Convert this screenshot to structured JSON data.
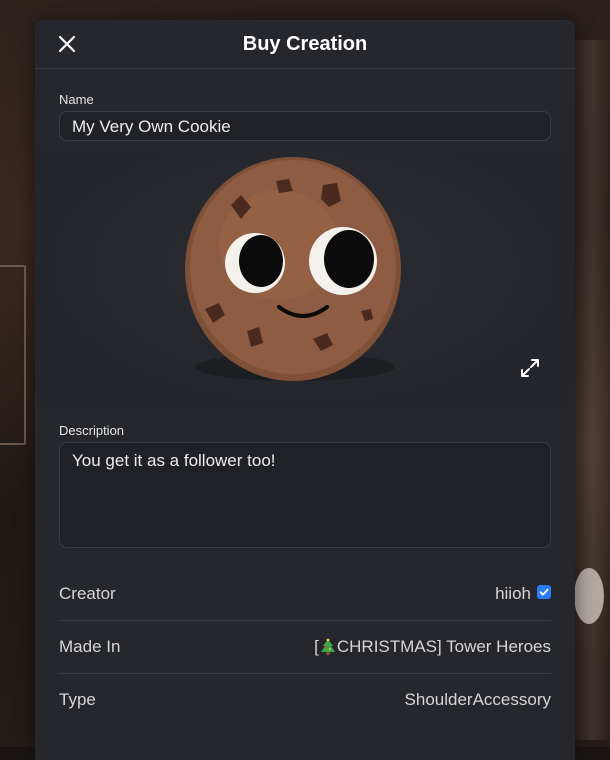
{
  "dialog": {
    "title": "Buy Creation"
  },
  "name": {
    "label": "Name",
    "value": "My Very Own Cookie"
  },
  "description": {
    "label": "Description",
    "value": "You get it as a follower too!"
  },
  "details": {
    "creator_label": "Creator",
    "creator_value": "hiioh",
    "made_in_label": "Made In",
    "made_in_prefix": "[",
    "made_in_suffix": "CHRISTMAS] Tower Heroes",
    "type_label": "Type",
    "type_value": "ShoulderAccessory"
  },
  "icons": {
    "close": "close-icon",
    "expand": "expand-icon",
    "verified": "verified-badge-icon",
    "tree": "christmas-tree-emoji"
  },
  "colors": {
    "dialog_bg": "#25272d",
    "verified_blue": "#2a7cf6",
    "cookie_brown": "#8a5a40"
  }
}
